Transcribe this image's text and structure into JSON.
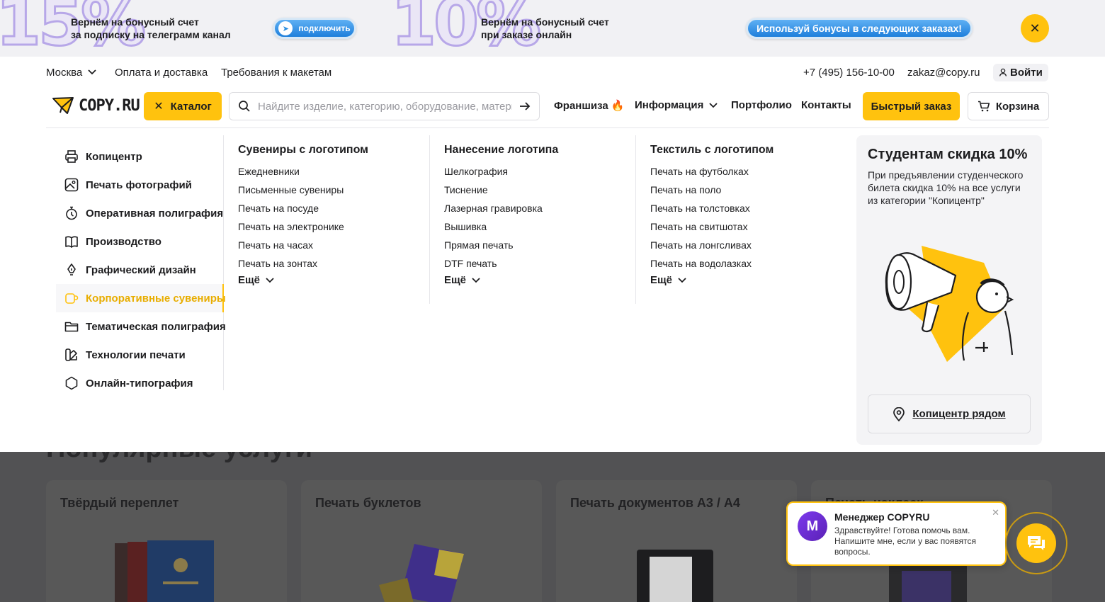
{
  "promo": {
    "left_big": "15%",
    "left_text_1": "Вернём на бонусный счет",
    "left_text_2": "за подписку на телеграмм канал",
    "connect_button": "подключить",
    "mid_big": "10%",
    "mid_text_1": "Вернём на бонусный счет",
    "mid_text_2": "при заказе онлайн",
    "use_bonus_button": "Используй бонусы в следующих заказах!",
    "close_icon": "close-icon"
  },
  "util": {
    "city": "Москва",
    "payment": "Оплата и доставка",
    "requirements": "Требования к макетам",
    "phone": "+7 (495) 156-10-00",
    "email": "zakaz@copy.ru",
    "login": "Войти"
  },
  "header": {
    "logo_text": "COPY.RU",
    "catalog_button": "Каталог",
    "search_placeholder": "Найдите изделие, категорию, оборудование, материал",
    "nav_franchise": "Франшиза 🔥",
    "nav_info": "Информация",
    "nav_portfolio": "Портфолио",
    "nav_contacts": "Контакты",
    "fast_order": "Быстрый заказ",
    "cart": "Корзина"
  },
  "sidebar": {
    "items": [
      {
        "label": "Копицентр",
        "icon": "printer-icon"
      },
      {
        "label": "Печать фотографий",
        "icon": "image-icon"
      },
      {
        "label": "Оперативная полиграфия",
        "icon": "stopwatch-icon"
      },
      {
        "label": "Производство",
        "icon": "book-icon"
      },
      {
        "label": "Графический дизайн",
        "icon": "pen-nib-icon"
      },
      {
        "label": "Корпоративные сувениры",
        "icon": "mug-icon"
      },
      {
        "label": "Тематическая полиграфия",
        "icon": "folder-icon"
      },
      {
        "label": "Технологии печати",
        "icon": "palette-icon"
      },
      {
        "label": "Онлайн-типография",
        "icon": "hexagon-icon"
      }
    ],
    "active_index": 5
  },
  "columns": [
    {
      "title": "Сувениры с логотипом",
      "links": [
        "Ежедневники",
        "Письменные сувениры",
        "Печать на посуде",
        "Печать на электронике",
        "Печать на часах",
        "Печать на зонтах"
      ],
      "more": "Ещё"
    },
    {
      "title": "Нанесение логотипа",
      "links": [
        "Шелкография",
        "Тиснение",
        "Лазерная гравировка",
        "Вышивка",
        "Прямая печать",
        "DTF печать"
      ],
      "more": "Ещё"
    },
    {
      "title": "Текстиль с логотипом",
      "links": [
        "Печать на футболках",
        "Печать на поло",
        "Печать на толстовках",
        "Печать на свитшотах",
        "Печать на лонгсливах",
        "Печать на водолазках"
      ],
      "more": "Ещё"
    }
  ],
  "student_card": {
    "title": "Студентам скидка 10%",
    "text": "При предъявлении студенческого билета скидка 10% на все услуги из категории \"Копицентр\"",
    "button": "Копицентр рядом"
  },
  "below": {
    "section_title": "Популярные услуги",
    "cards": [
      "Твёрдый переплет",
      "Печать буклетов",
      "Печать документов А3 / А4",
      "Печать наклеек"
    ]
  },
  "chat": {
    "name": "Менеджер COPYRU",
    "message": "Здравствуйте! Готова помочь вам. Напишите мне, если у вас появятся вопросы."
  },
  "colors": {
    "accent": "#ffc20e",
    "active_text": "#e8ad00",
    "pill_blue": "#1e7fdb",
    "overlay": "#525254"
  }
}
